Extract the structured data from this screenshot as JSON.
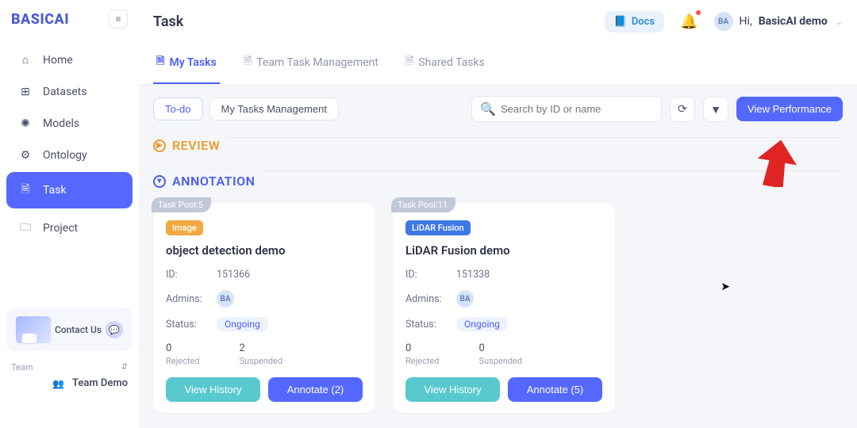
{
  "brand": "BASICAI",
  "header": {
    "page_title": "Task",
    "docs_label": "Docs",
    "greeting_prefix": "Hi, ",
    "username": "BasicAI demo",
    "avatar_initials": "BA"
  },
  "sidebar": {
    "items": [
      {
        "label": "Home",
        "icon": "⌂"
      },
      {
        "label": "Datasets",
        "icon": "⊞"
      },
      {
        "label": "Models",
        "icon": "✺"
      },
      {
        "label": "Ontology",
        "icon": "⚙"
      },
      {
        "label": "Task",
        "icon": "🗎"
      },
      {
        "label": "Project",
        "icon": "🗀"
      }
    ],
    "contact_label": "Contact Us",
    "team_label": "Team",
    "team_name": "Team Demo"
  },
  "tabs": [
    {
      "label": "My Tasks"
    },
    {
      "label": "Team Task Management"
    },
    {
      "label": "Shared Tasks"
    }
  ],
  "toolbar": {
    "seg": [
      "To-do",
      "My Tasks Management"
    ],
    "search_placeholder": "Search by ID or name",
    "view_performance": "View Performance"
  },
  "sections": {
    "review": "REVIEW",
    "annotation": "ANNOTATION"
  },
  "labels": {
    "task_pool_prefix": "Task Pool:",
    "id": "ID:",
    "admins": "Admins:",
    "status": "Status:",
    "rejected": "Rejected",
    "suspended": "Suspended",
    "view_history": "View History",
    "annotate_prefix": "Annotate"
  },
  "cards": [
    {
      "pool": 5,
      "tag": "Image",
      "tag_color": "orange",
      "title": "object detection demo",
      "id": "151366",
      "admin_initials": "BA",
      "status": "Ongoing",
      "rejected": 0,
      "suspended": 2,
      "annotate_count": 2
    },
    {
      "pool": 11,
      "tag": "LiDAR Fusion",
      "tag_color": "blue",
      "title": "LiDAR Fusion demo",
      "id": "151338",
      "admin_initials": "BA",
      "status": "Ongoing",
      "rejected": 0,
      "suspended": 0,
      "annotate_count": 5
    }
  ]
}
